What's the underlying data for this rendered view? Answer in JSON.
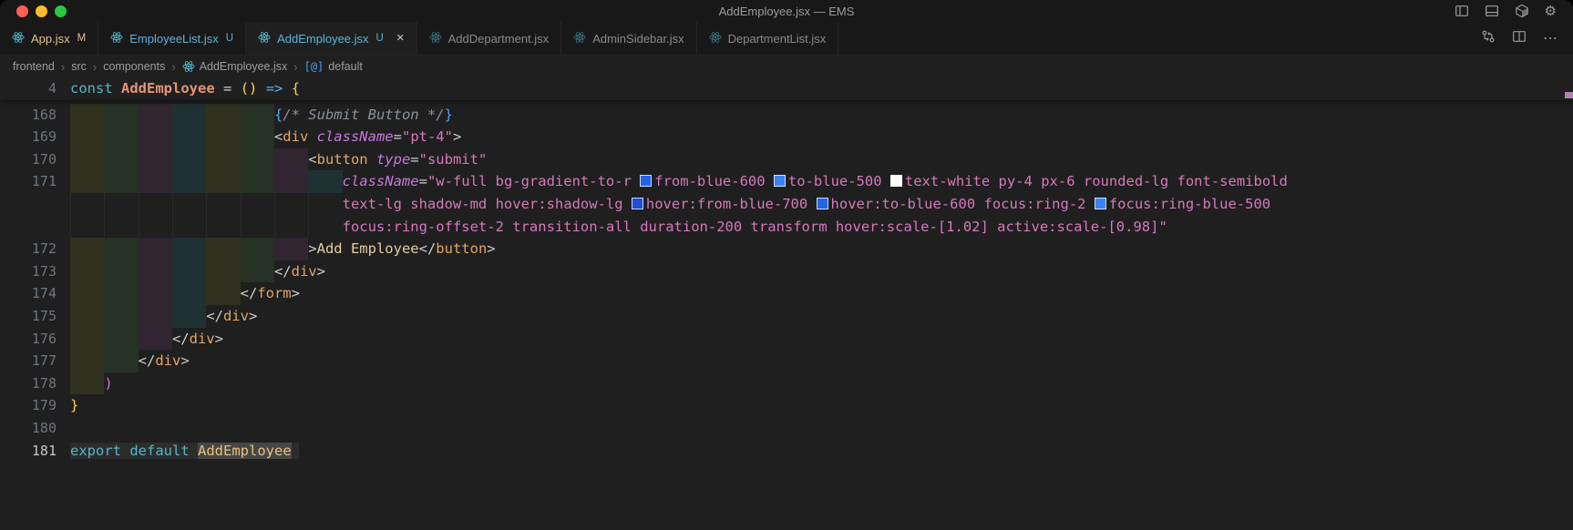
{
  "titlebar": {
    "title": "AddEmployee.jsx — EMS",
    "traffic_lights": [
      {
        "name": "close-button",
        "color": "#ff5f57"
      },
      {
        "name": "minimize-button",
        "color": "#febc2e"
      },
      {
        "name": "zoom-button",
        "color": "#28c840"
      }
    ],
    "actions": [
      {
        "name": "toggle-sidebar-button",
        "icon": "layout-sidebar-icon"
      },
      {
        "name": "toggle-panel-button",
        "icon": "layout-panel-icon"
      },
      {
        "name": "extension-button",
        "icon": "cube-icon"
      },
      {
        "name": "settings-button",
        "icon": "gear-icon",
        "glyph": "⚙"
      }
    ]
  },
  "tabbar": {
    "tabs": [
      {
        "label": "App.jsx",
        "badge": "M",
        "state": "modified",
        "active": false,
        "closable": false
      },
      {
        "label": "EmployeeList.jsx",
        "badge": "U",
        "state": "untracked",
        "active": false,
        "closable": false
      },
      {
        "label": "AddEmployee.jsx",
        "badge": "U",
        "state": "untracked",
        "active": true,
        "closable": true
      },
      {
        "label": "AddDepartment.jsx",
        "badge": "",
        "state": "idle",
        "active": false,
        "closable": false
      },
      {
        "label": "AdminSidebar.jsx",
        "badge": "",
        "state": "idle",
        "active": false,
        "closable": false
      },
      {
        "label": "DepartmentList.jsx",
        "badge": "",
        "state": "idle",
        "active": false,
        "closable": false
      }
    ],
    "close_glyph": "×",
    "state_colors": {
      "modified": "#e2c08d",
      "untracked": "#5cb3dd",
      "idle": "#8a8a8a"
    },
    "actions": [
      {
        "name": "open-changes-button",
        "icon": "git-compare-icon"
      },
      {
        "name": "split-editor-button",
        "icon": "split-editor-icon"
      },
      {
        "name": "more-actions-button",
        "icon": "ellipsis-icon",
        "glyph": "⋯"
      }
    ]
  },
  "breadcrumb": {
    "separator": "›",
    "items": [
      {
        "label": "frontend",
        "icon": ""
      },
      {
        "label": "src",
        "icon": ""
      },
      {
        "label": "components",
        "icon": ""
      },
      {
        "label": "AddEmployee.jsx",
        "icon": "react"
      },
      {
        "label": "default",
        "icon": "symbol-default",
        "symbol_glyph": "[@]"
      }
    ]
  },
  "editor": {
    "react_icon_color": "#58c4dc",
    "scroll_marker_color": "#b084b0",
    "sticky_line": {
      "num": "4",
      "indent": 0,
      "tokens": [
        [
          "kw",
          "const"
        ],
        [
          "plain",
          " "
        ],
        [
          "fn",
          "AddEmployee"
        ],
        [
          "plain",
          " "
        ],
        [
          "punc",
          "="
        ],
        [
          "plain",
          " "
        ],
        [
          "brk1",
          "()"
        ],
        [
          "plain",
          " "
        ],
        [
          "arrow",
          "=>"
        ],
        [
          "plain",
          " "
        ],
        [
          "brk1",
          "{"
        ]
      ]
    },
    "lines": [
      {
        "num": "168",
        "indent": 24,
        "tokens": [
          [
            "brk3",
            "{"
          ],
          [
            "cmt",
            "/* Submit Button */"
          ],
          [
            "brk3",
            "}"
          ]
        ]
      },
      {
        "num": "169",
        "indent": 24,
        "tokens": [
          [
            "punc",
            "<"
          ],
          [
            "tag",
            "div"
          ],
          [
            "plain",
            " "
          ],
          [
            "attr",
            "className"
          ],
          [
            "punc",
            "="
          ],
          [
            "str",
            "\"pt-4\""
          ],
          [
            "punc",
            ">"
          ]
        ]
      },
      {
        "num": "170",
        "indent": 28,
        "tokens": [
          [
            "punc",
            "<"
          ],
          [
            "tag",
            "button"
          ],
          [
            "plain",
            " "
          ],
          [
            "attr",
            "type"
          ],
          [
            "punc",
            "="
          ],
          [
            "str",
            "\"submit\""
          ]
        ]
      },
      {
        "num": "171",
        "indent": 32,
        "tokens": [
          [
            "attr",
            "className"
          ],
          [
            "punc",
            "="
          ],
          [
            "str",
            "\"w-full bg-gradient-to-r "
          ],
          [
            "swatch",
            "#2563eb"
          ],
          [
            "str",
            "from-blue-600 "
          ],
          [
            "swatch",
            "#3b82f6"
          ],
          [
            "str",
            "to-blue-500 "
          ],
          [
            "swatch",
            "#ffffff"
          ],
          [
            "str",
            "text-white py-4 px-6 rounded-lg font-semibold"
          ]
        ]
      },
      {
        "num": "",
        "wrap": true,
        "indent": 32,
        "tokens": [
          [
            "str",
            "text-lg shadow-md hover:shadow-lg "
          ],
          [
            "swatch",
            "#1d4ed8"
          ],
          [
            "str",
            "hover:from-blue-700 "
          ],
          [
            "swatch",
            "#2563eb"
          ],
          [
            "str",
            "hover:to-blue-600 focus:ring-2 "
          ],
          [
            "swatch",
            "#3b82f6"
          ],
          [
            "str",
            "focus:ring-blue-500"
          ]
        ]
      },
      {
        "num": "",
        "wrap": true,
        "indent": 32,
        "tokens": [
          [
            "str",
            "focus:ring-offset-2 transition-all duration-200 transform hover:scale-[1.02] active:scale-[0.98]\""
          ]
        ]
      },
      {
        "num": "172",
        "indent": 28,
        "tokens": [
          [
            "punc",
            ">"
          ],
          [
            "jsx",
            "Add Employee"
          ],
          [
            "punc",
            "</"
          ],
          [
            "tag",
            "button"
          ],
          [
            "punc",
            ">"
          ]
        ]
      },
      {
        "num": "173",
        "indent": 24,
        "tokens": [
          [
            "punc",
            "</"
          ],
          [
            "tag",
            "div"
          ],
          [
            "punc",
            ">"
          ]
        ]
      },
      {
        "num": "174",
        "indent": 20,
        "tokens": [
          [
            "punc",
            "</"
          ],
          [
            "tag",
            "form"
          ],
          [
            "punc",
            ">"
          ]
        ]
      },
      {
        "num": "175",
        "indent": 16,
        "tokens": [
          [
            "punc",
            "</"
          ],
          [
            "tag",
            "div"
          ],
          [
            "punc",
            ">"
          ]
        ]
      },
      {
        "num": "176",
        "indent": 12,
        "tokens": [
          [
            "punc",
            "</"
          ],
          [
            "tag",
            "div"
          ],
          [
            "punc",
            ">"
          ]
        ]
      },
      {
        "num": "177",
        "indent": 8,
        "tokens": [
          [
            "punc",
            "</"
          ],
          [
            "tag",
            "div"
          ],
          [
            "punc",
            ">"
          ]
        ]
      },
      {
        "num": "178",
        "indent": 4,
        "tokens": [
          [
            "brk2",
            ")"
          ]
        ]
      },
      {
        "num": "179",
        "indent": 0,
        "tokens": [
          [
            "brk1",
            "}"
          ]
        ]
      },
      {
        "num": "180",
        "indent": 0,
        "tokens": []
      },
      {
        "num": "181",
        "indent": 0,
        "active": true,
        "strip": true,
        "tokens": [
          [
            "kw",
            "export"
          ],
          [
            "plain",
            " "
          ],
          [
            "kw",
            "default"
          ],
          [
            "plain",
            " "
          ],
          [
            "varhl",
            "AddEmployee"
          ]
        ]
      }
    ]
  }
}
